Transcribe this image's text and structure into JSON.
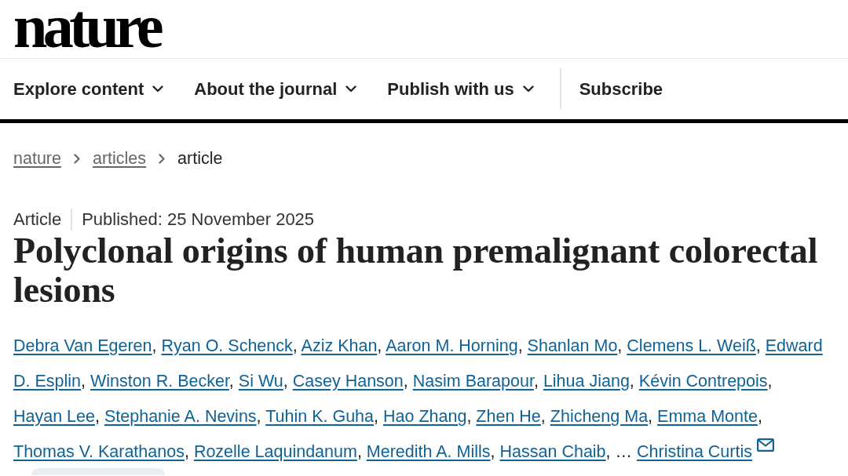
{
  "logo": {
    "text": "nature"
  },
  "nav": [
    {
      "label": "Explore content",
      "kind": "dropdown"
    },
    {
      "label": "About the journal",
      "kind": "dropdown"
    },
    {
      "label": "Publish with us",
      "kind": "dropdown"
    },
    {
      "label": "Subscribe",
      "kind": "link"
    }
  ],
  "breadcrumb": [
    {
      "label": "nature",
      "current": false
    },
    {
      "label": "articles",
      "current": false
    },
    {
      "label": "article",
      "current": true
    }
  ],
  "article": {
    "type": "Article",
    "published": "Published: 25 November 2025",
    "title": "Polyclonal origins of human premalignant colorectal lesions",
    "author_lines": [
      [
        {
          "kind": "author",
          "name": "Debra Van Egeren",
          "separator": ",",
          "corresponding": false
        },
        {
          "kind": "author",
          "name": "Ryan O. Schenck",
          "separator": ",",
          "corresponding": false
        },
        {
          "kind": "author",
          "name": "Aziz Khan",
          "separator": ",",
          "corresponding": false
        },
        {
          "kind": "author",
          "name": "Aaron M. Horning",
          "separator": ",",
          "corresponding": false
        },
        {
          "kind": "author",
          "name": "Shanlan Mo",
          "separator": ",",
          "corresponding": false
        },
        {
          "kind": "author",
          "name": "Clemens L. Weiß",
          "separator": ",",
          "corresponding": false
        },
        {
          "kind": "author",
          "name": "Edward",
          "corresponding": false
        }
      ],
      [
        {
          "kind": "author",
          "name": "D. Esplin",
          "separator": ",",
          "corresponding": false
        },
        {
          "kind": "author",
          "name": "Winston R. Becker",
          "separator": ",",
          "corresponding": false
        },
        {
          "kind": "author",
          "name": "Si Wu",
          "separator": ",",
          "corresponding": false
        },
        {
          "kind": "author",
          "name": "Casey Hanson",
          "separator": ",",
          "corresponding": false
        },
        {
          "kind": "author",
          "name": "Nasim Barapour",
          "separator": ",",
          "corresponding": false
        },
        {
          "kind": "author",
          "name": "Lihua Jiang",
          "separator": ",",
          "corresponding": false
        },
        {
          "kind": "author",
          "name": "Kévin Contrepois",
          "separator": ",",
          "corresponding": false
        }
      ],
      [
        {
          "kind": "author",
          "name": "Hayan Lee",
          "separator": ",",
          "corresponding": false
        },
        {
          "kind": "author",
          "name": "Stephanie A. Nevins",
          "separator": ",",
          "corresponding": false
        },
        {
          "kind": "author",
          "name": "Tuhin K. Guha",
          "separator": ",",
          "corresponding": false
        },
        {
          "kind": "author",
          "name": "Hao Zhang",
          "separator": ",",
          "corresponding": false
        },
        {
          "kind": "author",
          "name": "Zhen He",
          "separator": ",",
          "corresponding": false
        },
        {
          "kind": "author",
          "name": "Zhicheng Ma",
          "separator": ",",
          "corresponding": false
        },
        {
          "kind": "author",
          "name": "Emma Monte",
          "separator": ",",
          "corresponding": false
        }
      ],
      [
        {
          "kind": "author",
          "name": "Thomas V. Karathanos",
          "separator": ",",
          "corresponding": false
        },
        {
          "kind": "author",
          "name": "Rozelle Laquindanum",
          "separator": ",",
          "corresponding": false
        },
        {
          "kind": "author",
          "name": "Meredith A. Mills",
          "separator": ",",
          "corresponding": false
        },
        {
          "kind": "author",
          "name": "Hassan Chaib",
          "separator": ",",
          "corresponding": false
        },
        {
          "kind": "ellipsis",
          "text": "…"
        },
        {
          "kind": "author",
          "name": "Christina Curtis",
          "corresponding": true
        }
      ]
    ]
  }
}
